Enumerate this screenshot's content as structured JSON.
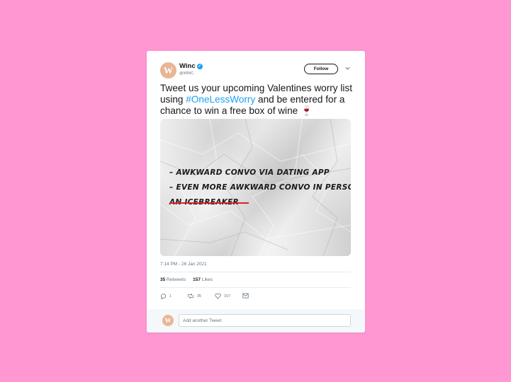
{
  "tweet": {
    "author": {
      "name": "Winc",
      "handle": "@WINC",
      "avatar_letter": "W",
      "verified": true
    },
    "follow_label": "Follow",
    "text_before": "Tweet us your upcoming Valentines worry list using ",
    "hashtag": "#OneLessWorry",
    "text_after": " and be entered for a chance to win a free box of wine 🍷",
    "image_lines": [
      "– Awkward convo via dating app",
      "– Even more awkward convo in person",
      "An icebreaker"
    ],
    "timestamp": "7:14 PM - 26 Jan 2021",
    "stats": {
      "retweets_count": "35",
      "retweets_label": "Retweets",
      "likes_count": "157",
      "likes_label": "Likes"
    },
    "actions": {
      "reply_count": "1",
      "retweet_count": "35",
      "like_count": "157"
    },
    "reply_placeholder": "Add another Tweet"
  },
  "colors": {
    "background": "#ff97d3",
    "accent": "#1da1f2",
    "avatar": "#e9b593",
    "strike": "#d8232a"
  }
}
